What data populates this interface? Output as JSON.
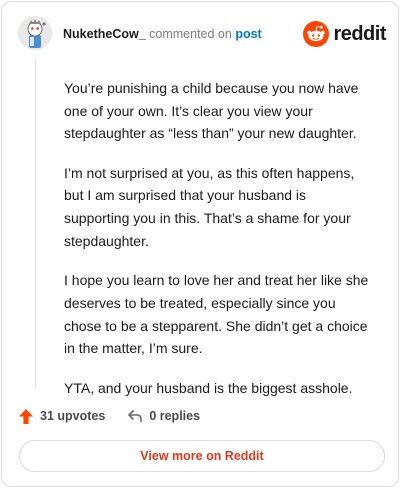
{
  "header": {
    "username": "NuketheCow_",
    "action_text": "commented on",
    "post_link": "post",
    "brand_name": "reddit",
    "avatar_icon": "snoo-avatar-icon",
    "brand_icon": "reddit-snoo-icon"
  },
  "comment": {
    "paragraphs": [
      "You’re punishing a child because you now have one of your own. It’s clear you view your stepdaughter as “less than” your new daughter.",
      "I’m not surprised at you, as this often happens, but I am surprised that your husband is supporting you in this. That’s a shame for your stepdaughter.",
      "I hope you learn to love her and treat her like she deserves to be treated, especially since you chose to be a stepparent. She didn’t get a choice in the matter, I’m sure.",
      "YTA, and your husband is the biggest asshole."
    ]
  },
  "actions": {
    "upvotes_label": "31 upvotes",
    "replies_label": "0 replies",
    "upvote_icon": "upvote-arrow-icon",
    "reply_icon": "reply-arrow-icon"
  },
  "footer": {
    "view_more_label": "View more on Reddit"
  },
  "colors": {
    "accent": "#ff4500",
    "link": "#0079d3",
    "view_more_text": "#e03a1a",
    "muted_text": "#7c7c7c"
  }
}
